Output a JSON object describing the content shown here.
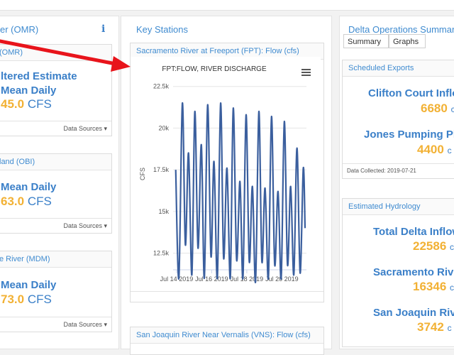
{
  "left": {
    "title": "er (OMR)",
    "card1": {
      "header": "(OMR)",
      "line1": "ltered Estimate",
      "line2": "Mean Daily",
      "value": "45.0",
      "unit": "CFS",
      "footer": "Data Sources ▾"
    },
    "card2": {
      "header": "land (OBI)",
      "line1": "Mean Daily",
      "value": "63.0",
      "unit": "CFS",
      "footer": "Data Sources ▾"
    },
    "card3": {
      "header": "e River (MDM)",
      "line1": "Mean Daily",
      "value": "73.0",
      "unit": "CFS",
      "footer": "Data Sources ▾"
    }
  },
  "middle": {
    "title": "Key Stations",
    "chart_card_header": "Sacramento River at Freeport (FPT): Flow (cfs)",
    "next_card_header": "San Joaquin River Near Vernalis (VNS): Flow (cfs)"
  },
  "right": {
    "title": "Delta Operations Summary",
    "tabs": [
      "Summary",
      "Graphs"
    ],
    "exports": {
      "header": "Scheduled Exports",
      "items": [
        {
          "label": "Clifton Court Inflo",
          "value": "6680",
          "unit": "c"
        },
        {
          "label": "Jones Pumping Pla",
          "value": "4400",
          "unit": "c"
        }
      ],
      "footer": "Data Collected: 2019-07-21"
    },
    "hydrology": {
      "header": "Estimated Hydrology",
      "items": [
        {
          "label": "Total Delta Inflow",
          "value": "22586",
          "unit": "c"
        },
        {
          "label": "Sacramento Rive",
          "value": "16346",
          "unit": "c"
        },
        {
          "label": "San Joaquin Rive",
          "value": "3742",
          "unit": "c"
        }
      ]
    }
  },
  "colors": {
    "accent": "#3a7fc8",
    "value": "#f2b134",
    "line": "#3b5f9e",
    "arrow": "#e8141b"
  },
  "chart_data": {
    "type": "line",
    "title": "FPT:FLOW, RIVER DISCHARGE",
    "xlabel": "",
    "ylabel": "CFS",
    "y_ticks": [
      "12.5k",
      "15k",
      "17.5k",
      "20k",
      "22.5k"
    ],
    "y_tick_values": [
      12500,
      15000,
      17500,
      20000,
      22500
    ],
    "ylim": [
      11500,
      23000
    ],
    "x_ticks": [
      "Jul 14 2019",
      "Jul 16 2019",
      "Jul 18 2019",
      "Jul 20 2019"
    ],
    "x_tick_values": [
      14,
      16,
      18,
      20
    ],
    "xlim": [
      13.8,
      21.4
    ],
    "grid": true,
    "series": [
      {
        "name": "",
        "x": [
          13.95,
          14.13,
          14.33,
          14.5,
          14.68,
          14.87,
          15.04,
          15.22,
          15.41,
          15.58,
          15.77,
          15.96,
          16.13,
          16.32,
          16.51,
          16.68,
          16.87,
          17.06,
          17.23,
          17.42,
          17.61,
          17.78,
          17.96,
          18.14,
          18.32,
          18.5,
          18.69,
          18.86,
          19.04,
          19.23,
          19.41,
          19.59,
          19.78,
          19.96,
          20.14,
          20.32,
          20.5,
          20.68,
          20.86,
          21.04,
          21.22,
          21.32
        ],
        "y": [
          17500,
          11000,
          21500,
          13000,
          18500,
          11200,
          21000,
          12800,
          19000,
          11000,
          21400,
          12300,
          18000,
          11000,
          21500,
          12200,
          17600,
          11000,
          21200,
          12100,
          16800,
          11000,
          20800,
          12000,
          16500,
          10800,
          21000,
          12000,
          16400,
          11000,
          20700,
          11800,
          16200,
          11000,
          20400,
          11800,
          16500,
          11200,
          18800,
          11300,
          17600,
          14000
        ]
      }
    ]
  }
}
